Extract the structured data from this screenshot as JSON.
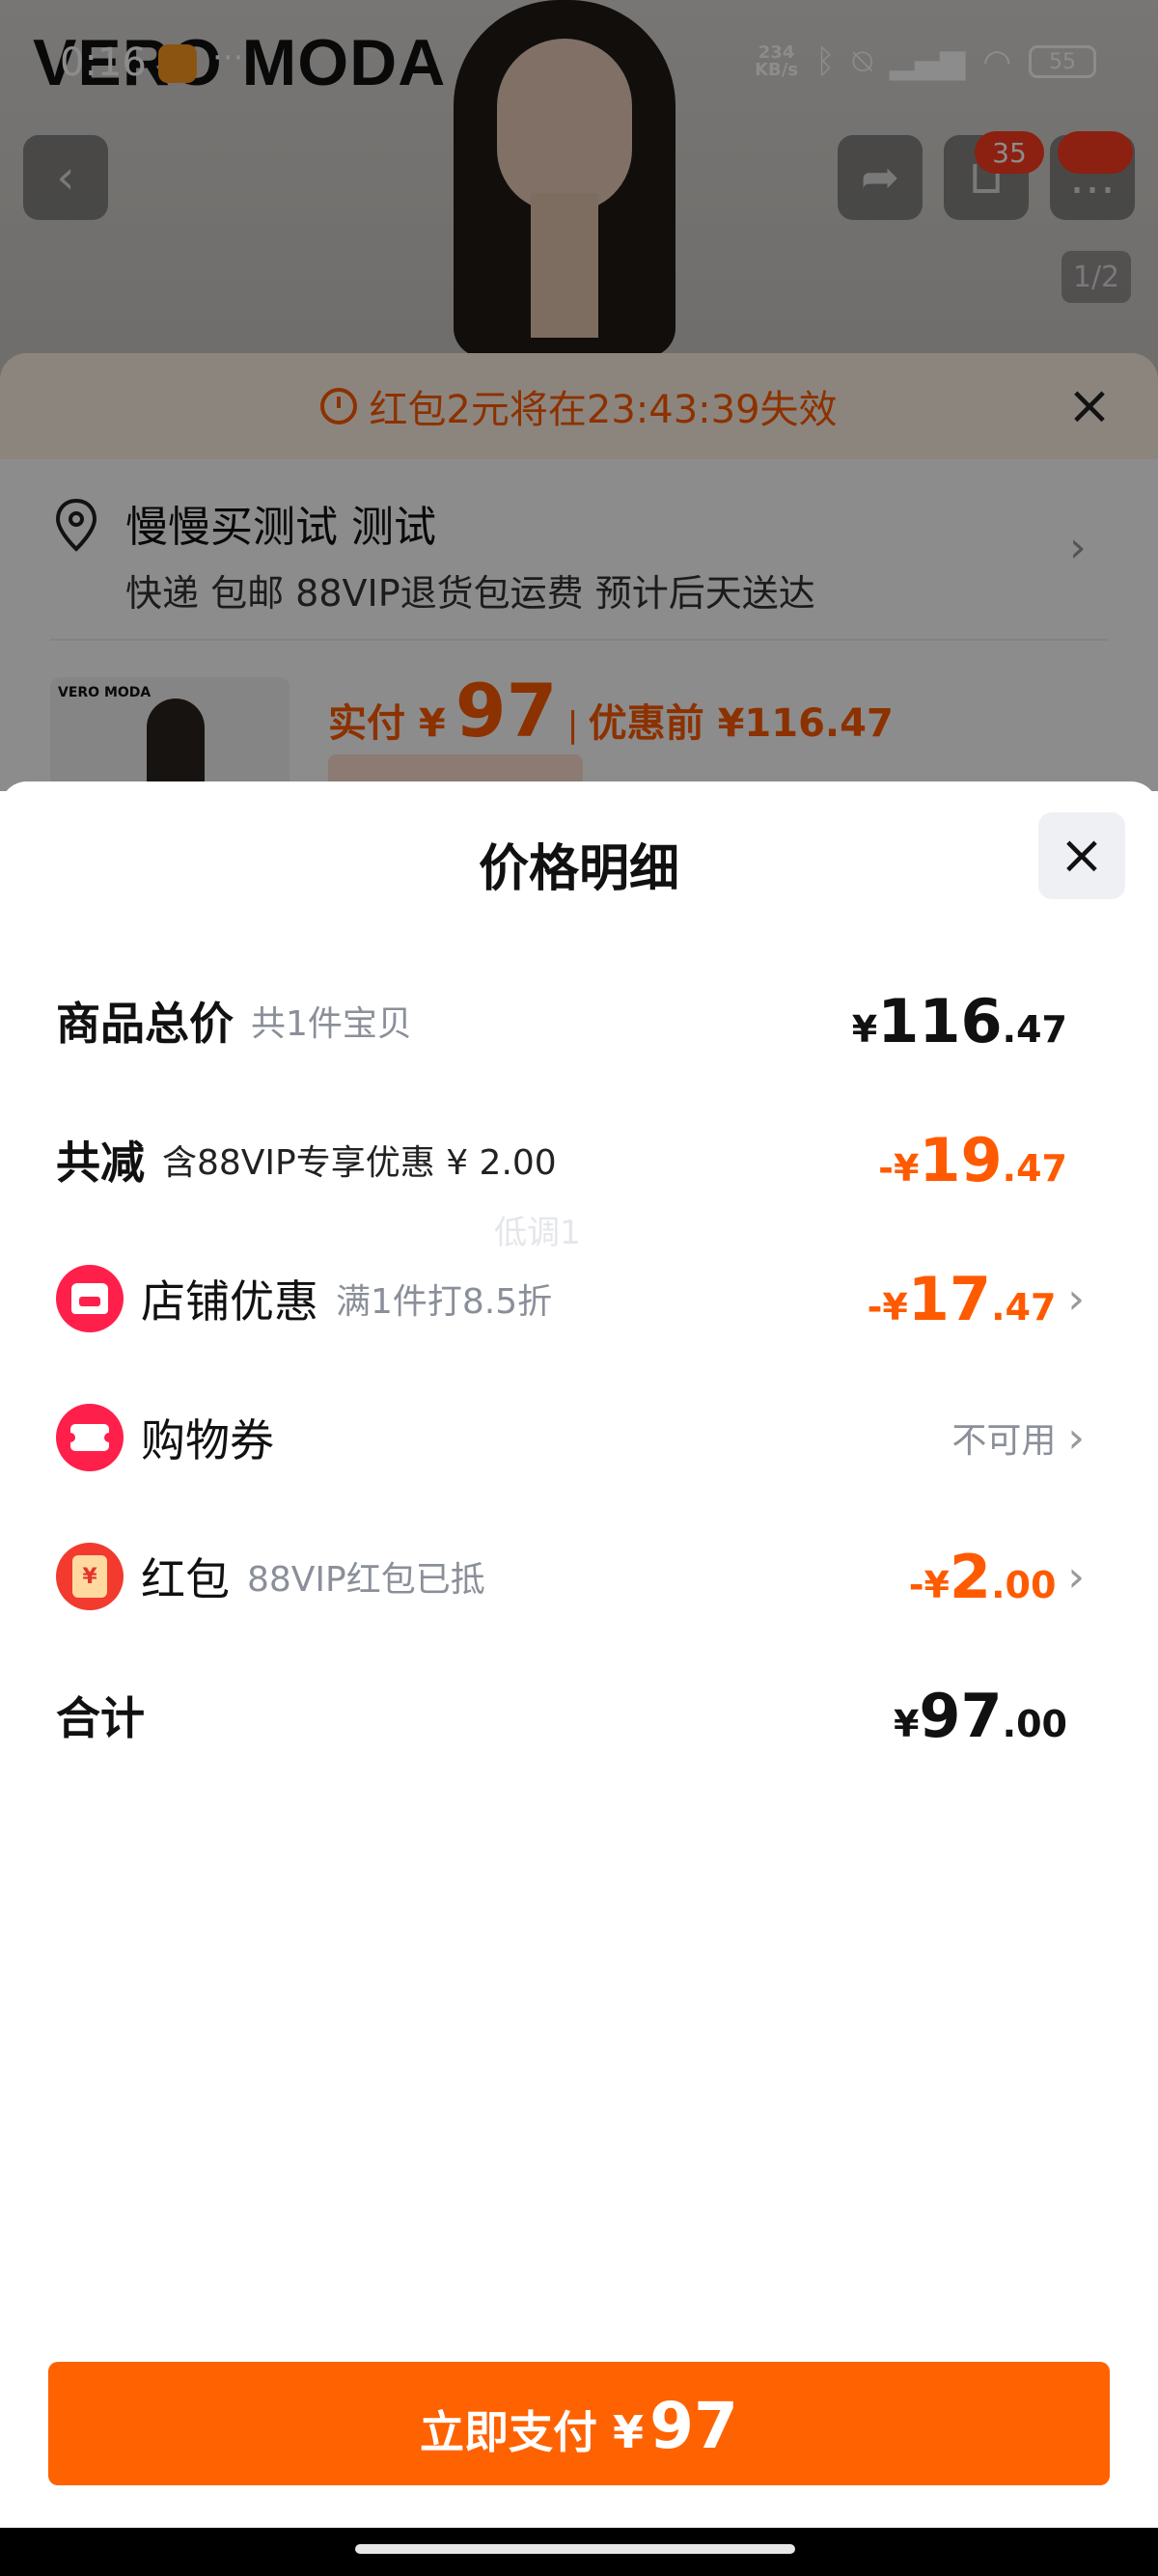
{
  "status_bar": {
    "time": "0:16",
    "more": "···",
    "net_speed_value": "234",
    "net_speed_unit": "KB/s",
    "battery": "55"
  },
  "background": {
    "brand": "VERO MODA",
    "cart_badge": "35",
    "image_counter": "1/2",
    "coupon_timer": "红包2元将在23:43:39失效",
    "address_name": "慢慢买测试 测试",
    "address_detail": "快递 包邮 88VIP退货包运费 预计后天送达",
    "thumb_brand": "VERO MODA",
    "pay_label": "实付 ¥",
    "pay_amount": "97",
    "pay_separator": "|",
    "price_before": "优惠前 ¥116.47"
  },
  "sheet": {
    "title": "价格明细",
    "watermark": "低调1",
    "rows": [
      {
        "label": "商品总价",
        "sub": "共1件宝贝",
        "amount_sym": "¥",
        "amount_int": "116",
        "amount_dec": ".47"
      },
      {
        "label": "共减",
        "sub": "含88VIP专享优惠 ¥ 2.00",
        "amount_sym": "-¥",
        "amount_int": "19",
        "amount_dec": ".47"
      },
      {
        "label": "店铺优惠",
        "sub": "满1件打8.5折",
        "amount_sym": "-¥",
        "amount_int": "17",
        "amount_dec": ".47"
      },
      {
        "label": "购物券",
        "status": "不可用"
      },
      {
        "label": "红包",
        "sub": "88VIP红包已抵",
        "amount_sym": "-¥",
        "amount_int": "2",
        "amount_dec": ".00",
        "icon_text": "¥"
      },
      {
        "label": "合计",
        "amount_sym": "¥",
        "amount_int": "97",
        "amount_dec": ".00"
      }
    ],
    "pay_button": {
      "label": "立即支付 ¥",
      "amount": "97"
    }
  },
  "icons": {
    "back": "chevron-left-icon",
    "share": "share-icon",
    "cart": "cart-icon",
    "more": "message-icon",
    "close": "close-icon",
    "chevron": "chevron-right-icon"
  },
  "colors": {
    "accent": "#ff6200",
    "discount": "#ff5a00",
    "icon_red": "#ff1f4b"
  }
}
